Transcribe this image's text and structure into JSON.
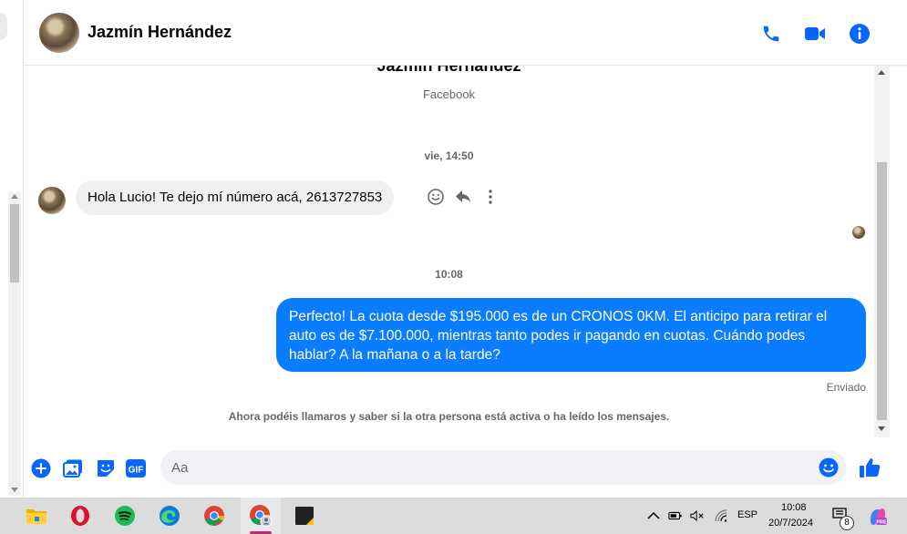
{
  "header": {
    "contact_name": "Jazmín Hernández"
  },
  "chat": {
    "intro_name": "Jazmín Hernández",
    "intro_sub": "Facebook",
    "timestamp_1": "vie, 14:50",
    "incoming_message": "Hola Lucio! Te dejo mí número acá, 2613727853",
    "timestamp_2": "10:08",
    "outgoing_message": "Perfecto! La cuota desde $195.000 es de un CRONOS 0KM. El anticipo para retirar el auto es de $7.100.000, mientras tanto podes ir pagando en cuotas. Cuándo podes hablar? A la mañana o a la tarde?",
    "sent_status": "Enviado",
    "info_line": "Ahora podéis llamaros y saber si la otra persona está activa o ha leído los mensajes."
  },
  "composer": {
    "placeholder": "Aa",
    "gif_label": "GIF"
  },
  "icons": {
    "header": [
      "phone-icon",
      "video-camera-icon",
      "info-icon"
    ],
    "message_actions": [
      "react-icon",
      "reply-icon",
      "more-icon"
    ],
    "composer": [
      "plus-icon",
      "photo-icon",
      "sticker-icon",
      "gif-icon",
      "emoji-icon",
      "like-icon"
    ]
  },
  "taskbar": {
    "apps": [
      "file-explorer-icon",
      "opera-icon",
      "spotify-icon",
      "edge-icon",
      "chrome-icon",
      "chrome-profile-icon",
      "notes-app-icon"
    ],
    "language": "ESP",
    "time": "10:08",
    "date": "20/7/2024",
    "notification_count": "8"
  },
  "colors": {
    "accent": "#0a7cff",
    "brand_blue": "#0866ff",
    "incoming_bubble": "#f0f0f0",
    "taskbar": "#dcdcdc"
  }
}
